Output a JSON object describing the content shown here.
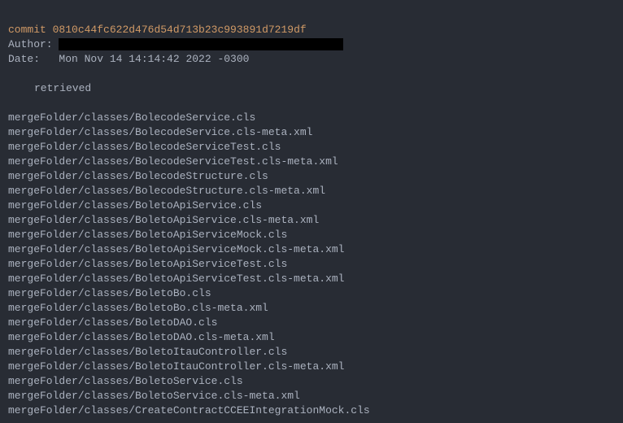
{
  "commit": {
    "label": "commit",
    "hash": "0810c44fc622d476d54d713b23c993891d7219df"
  },
  "author": {
    "label": "Author:"
  },
  "date": {
    "label": "Date:",
    "value": "Mon Nov 14 14:14:42 2022 -0300"
  },
  "message": "retrieved",
  "files": [
    "mergeFolder/classes/BolecodeService.cls",
    "mergeFolder/classes/BolecodeService.cls-meta.xml",
    "mergeFolder/classes/BolecodeServiceTest.cls",
    "mergeFolder/classes/BolecodeServiceTest.cls-meta.xml",
    "mergeFolder/classes/BolecodeStructure.cls",
    "mergeFolder/classes/BolecodeStructure.cls-meta.xml",
    "mergeFolder/classes/BoletoApiService.cls",
    "mergeFolder/classes/BoletoApiService.cls-meta.xml",
    "mergeFolder/classes/BoletoApiServiceMock.cls",
    "mergeFolder/classes/BoletoApiServiceMock.cls-meta.xml",
    "mergeFolder/classes/BoletoApiServiceTest.cls",
    "mergeFolder/classes/BoletoApiServiceTest.cls-meta.xml",
    "mergeFolder/classes/BoletoBo.cls",
    "mergeFolder/classes/BoletoBo.cls-meta.xml",
    "mergeFolder/classes/BoletoDAO.cls",
    "mergeFolder/classes/BoletoDAO.cls-meta.xml",
    "mergeFolder/classes/BoletoItauController.cls",
    "mergeFolder/classes/BoletoItauController.cls-meta.xml",
    "mergeFolder/classes/BoletoService.cls",
    "mergeFolder/classes/BoletoService.cls-meta.xml",
    "mergeFolder/classes/CreateContractCCEEIntegrationMock.cls"
  ]
}
